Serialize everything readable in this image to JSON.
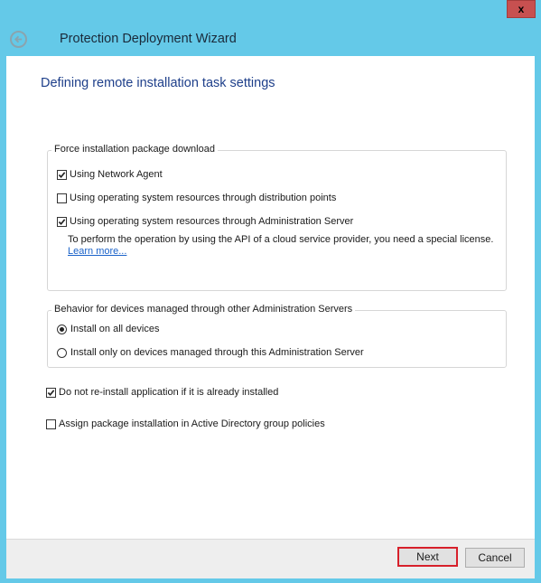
{
  "window": {
    "title": "Protection Deployment Wizard",
    "close_label": "x",
    "back_icon": "back-arrow-circle-icon"
  },
  "page": {
    "heading": "Defining remote installation task settings"
  },
  "force_download": {
    "legend": "Force installation package download",
    "options": [
      {
        "label": "Using Network Agent",
        "checked": true
      },
      {
        "label": "Using operating system resources through distribution points",
        "checked": false
      },
      {
        "label": "Using operating system resources through Administration Server",
        "checked": true
      }
    ],
    "note": "To perform the operation by using the API of a cloud service provider, you need a special license.",
    "link": "Learn more..."
  },
  "behavior": {
    "legend": "Behavior for devices managed through other Administration Servers",
    "options": [
      {
        "label": "Install on all devices",
        "selected": true
      },
      {
        "label": "Install only on devices managed through this Administration Server",
        "selected": false
      }
    ]
  },
  "standalone_options": [
    {
      "label": "Do not re-install application if it is already installed",
      "checked": true
    },
    {
      "label": "Assign package installation in Active Directory group policies",
      "checked": false
    }
  ],
  "footer": {
    "next_label": "Next",
    "cancel_label": "Cancel",
    "highlight_color": "#d7202b"
  }
}
